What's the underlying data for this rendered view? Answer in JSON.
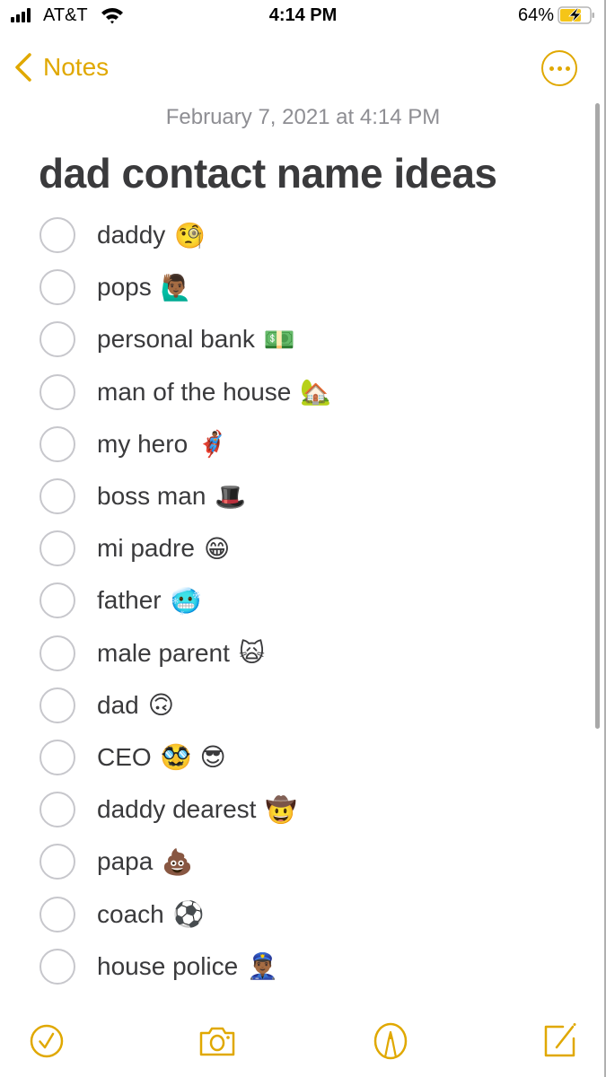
{
  "status_bar": {
    "carrier": "AT&T",
    "time": "4:14 PM",
    "battery_percent": "64%",
    "battery_level": 0.64,
    "charging": true
  },
  "nav": {
    "back_label": "Notes",
    "more_icon": "ellipsis-circle-icon"
  },
  "note": {
    "date": "February 7, 2021 at 4:14 PM",
    "title": "dad contact name ideas",
    "items": [
      {
        "text": "daddy",
        "emoji": "🧐",
        "checked": false
      },
      {
        "text": "pops",
        "emoji": "🙋🏾‍♂️",
        "checked": false
      },
      {
        "text": "personal bank",
        "emoji": "💵",
        "checked": false
      },
      {
        "text": "man of the house",
        "emoji": "🏡",
        "checked": false
      },
      {
        "text": "my hero",
        "emoji": "🦸🏾‍♂️",
        "checked": false
      },
      {
        "text": "boss man",
        "emoji": "🎩",
        "checked": false
      },
      {
        "text": "mi padre",
        "emoji": "😁",
        "checked": false
      },
      {
        "text": "father",
        "emoji": "🥶",
        "checked": false
      },
      {
        "text": "male parent",
        "emoji": "🙀",
        "checked": false
      },
      {
        "text": "dad",
        "emoji": "🙃",
        "checked": false
      },
      {
        "text": "CEO",
        "emoji": "🥸 😎",
        "checked": false
      },
      {
        "text": "daddy dearest",
        "emoji": "🤠",
        "checked": false
      },
      {
        "text": "papa",
        "emoji": "💩",
        "checked": false
      },
      {
        "text": "coach",
        "emoji": "⚽",
        "checked": false
      },
      {
        "text": "house police",
        "emoji": "👮🏾‍♂️",
        "checked": false
      }
    ]
  },
  "toolbar": {
    "items": [
      "checklist-icon",
      "camera-icon",
      "markup-icon",
      "compose-icon"
    ]
  },
  "colors": {
    "accent": "#e0a800",
    "text": "#3a3a3c",
    "secondary_text": "#8e8e93",
    "checkbox_border": "#c7c7cc"
  }
}
